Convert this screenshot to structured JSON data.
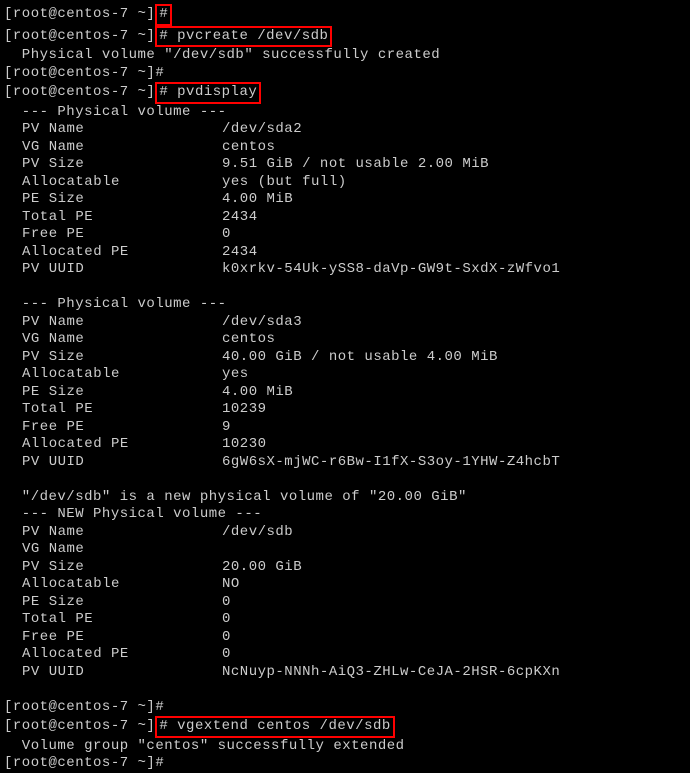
{
  "prompts": {
    "p1": "[root@centos-7 ~]",
    "hash": "#"
  },
  "cmds": {
    "pvcreate": " pvcreate /dev/sdb",
    "pvdisplay": " pvdisplay",
    "vgextend": " vgextend centos /dev/sdb"
  },
  "msgs": {
    "pvcreate_ok": "  Physical volume \"/dev/sdb\" successfully created",
    "vgextend_ok": "  Volume group \"centos\" successfully extended",
    "newpv": "  \"/dev/sdb\" is a new physical volume of \"20.00 GiB\"",
    "header_pv": "  --- Physical volume ---",
    "header_new": "  --- NEW Physical volume ---"
  },
  "pv1": {
    "name_k": "PV Name",
    "name_v": "/dev/sda2",
    "vg_k": "VG Name",
    "vg_v": "centos",
    "size_k": "PV Size",
    "size_v": "9.51 GiB / not usable 2.00 MiB",
    "alloc_k": "Allocatable",
    "alloc_v": "yes (but full)",
    "pesize_k": "PE Size",
    "pesize_v": "4.00 MiB",
    "totpe_k": "Total PE",
    "totpe_v": "2434",
    "freepe_k": "Free PE",
    "freepe_v": "0",
    "allocpe_k": "Allocated PE",
    "allocpe_v": "2434",
    "uuid_k": "PV UUID",
    "uuid_v": "k0xrkv-54Uk-ySS8-daVp-GW9t-SxdX-zWfvo1"
  },
  "pv2": {
    "name_k": "PV Name",
    "name_v": "/dev/sda3",
    "vg_k": "VG Name",
    "vg_v": "centos",
    "size_k": "PV Size",
    "size_v": "40.00 GiB / not usable 4.00 MiB",
    "alloc_k": "Allocatable",
    "alloc_v": "yes",
    "pesize_k": "PE Size",
    "pesize_v": "4.00 MiB",
    "totpe_k": "Total PE",
    "totpe_v": "10239",
    "freepe_k": "Free PE",
    "freepe_v": "9",
    "allocpe_k": "Allocated PE",
    "allocpe_v": "10230",
    "uuid_k": "PV UUID",
    "uuid_v": "6gW6sX-mjWC-r6Bw-I1fX-S3oy-1YHW-Z4hcbT"
  },
  "pv3": {
    "name_k": "PV Name",
    "name_v": "/dev/sdb",
    "vg_k": "VG Name",
    "vg_v": "",
    "size_k": "PV Size",
    "size_v": "20.00 GiB",
    "alloc_k": "Allocatable",
    "alloc_v": "NO",
    "pesize_k": "PE Size",
    "pesize_v": "0   ",
    "totpe_k": "Total PE",
    "totpe_v": "0",
    "freepe_k": "Free PE",
    "freepe_v": "0",
    "allocpe_k": "Allocated PE",
    "allocpe_v": "0",
    "uuid_k": "PV UUID",
    "uuid_v": "NcNuyp-NNNh-AiQ3-ZHLw-CeJA-2HSR-6cpKXn"
  }
}
